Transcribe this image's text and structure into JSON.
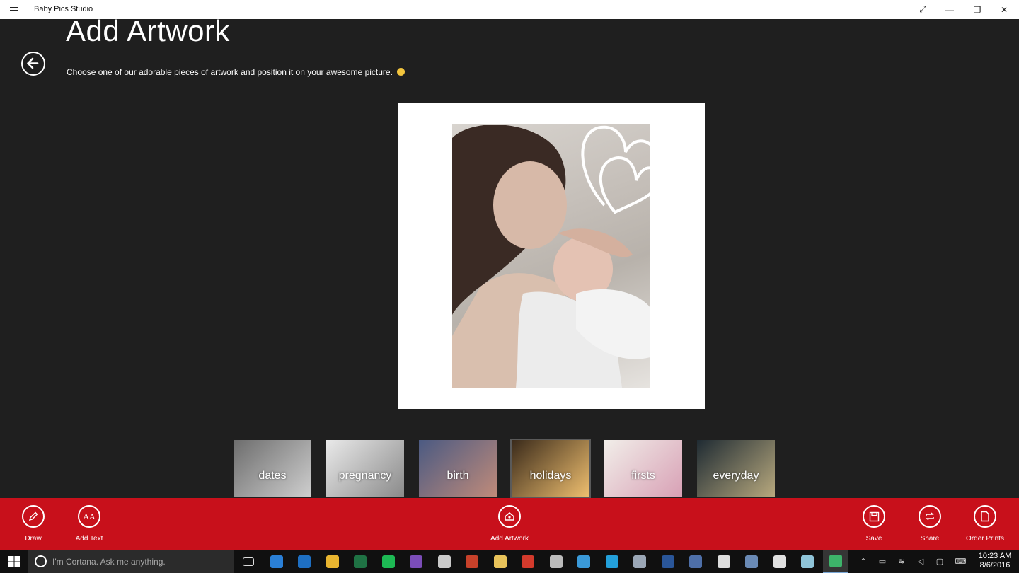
{
  "window": {
    "app_title": "Baby Pics Studio"
  },
  "page": {
    "title": "Add Artwork",
    "subtitle": "Choose one of our adorable pieces of artwork and position it on your awesome picture."
  },
  "categories": [
    {
      "label": "dates",
      "colors": [
        "#6d6d6d",
        "#cfcfcf"
      ]
    },
    {
      "label": "pregnancy",
      "colors": [
        "#e9e9e9",
        "#8a8a8a"
      ]
    },
    {
      "label": "birth",
      "colors": [
        "#4b5a82",
        "#c08b7a"
      ]
    },
    {
      "label": "holidays",
      "colors": [
        "#3a2a1a",
        "#f0c070"
      ],
      "selected": true
    },
    {
      "label": "firsts",
      "colors": [
        "#f1eee9",
        "#d8a0b5"
      ]
    },
    {
      "label": "everyday",
      "colors": [
        "#1f2b33",
        "#b8a97e"
      ]
    }
  ],
  "commands": {
    "draw": "Draw",
    "add_text": "Add Text",
    "add_artwork": "Add Artwork",
    "save": "Save",
    "share": "Share",
    "order_prints": "Order Prints"
  },
  "taskbar": {
    "search_placeholder": "I'm Cortana. Ask me anything.",
    "time": "10:23 AM",
    "date": "8/6/2016",
    "apps": [
      "task-view",
      "edge",
      "outlook",
      "chrome",
      "excel",
      "spotify",
      "visual-studio",
      "paint",
      "powerpoint",
      "file-explorer",
      "visual-studio-code",
      "tools",
      "internet-explorer",
      "skype",
      "photos",
      "word",
      "media",
      "slack",
      "remote-desktop",
      "store",
      "pen-app",
      "baby-pics-studio"
    ]
  },
  "colors": {
    "accent": "#c8101b",
    "background": "#1f1f1f"
  }
}
